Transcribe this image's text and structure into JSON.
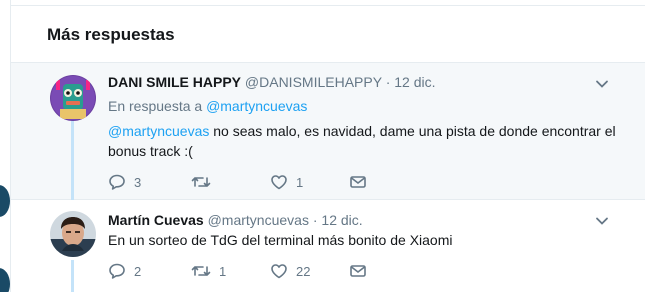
{
  "section": {
    "title": "Más respuestas"
  },
  "tweets": [
    {
      "name": "DANI SMILE HAPPY",
      "handle": "@DANISMILEHAPPY",
      "separator": "·",
      "date": "12 dic.",
      "reply_prefix": "En respuesta a",
      "reply_handle": "@martyncuevas",
      "mention": "@martyncuevas",
      "text": " no seas malo, es navidad, dame una pista de donde encontrar el bonus track :(",
      "replies": "3",
      "retweets": "",
      "likes": "1"
    },
    {
      "name": "Martín Cuevas",
      "handle": "@martyncuevas",
      "separator": "·",
      "date": "12 dic.",
      "text": "En un sorteo de TdG del terminal más bonito de Xiaomi",
      "replies": "2",
      "retweets": "1",
      "likes": "22"
    }
  ],
  "icons": {
    "reply": "reply-icon",
    "retweet": "retweet-icon",
    "like": "heart-icon",
    "dm": "envelope-icon",
    "caret": "chevron-down-icon"
  },
  "colors": {
    "accent": "#1da1f2",
    "muted": "#657786",
    "highlight_bg": "#f5f8fa",
    "thread_line": "#c4e3f9"
  }
}
